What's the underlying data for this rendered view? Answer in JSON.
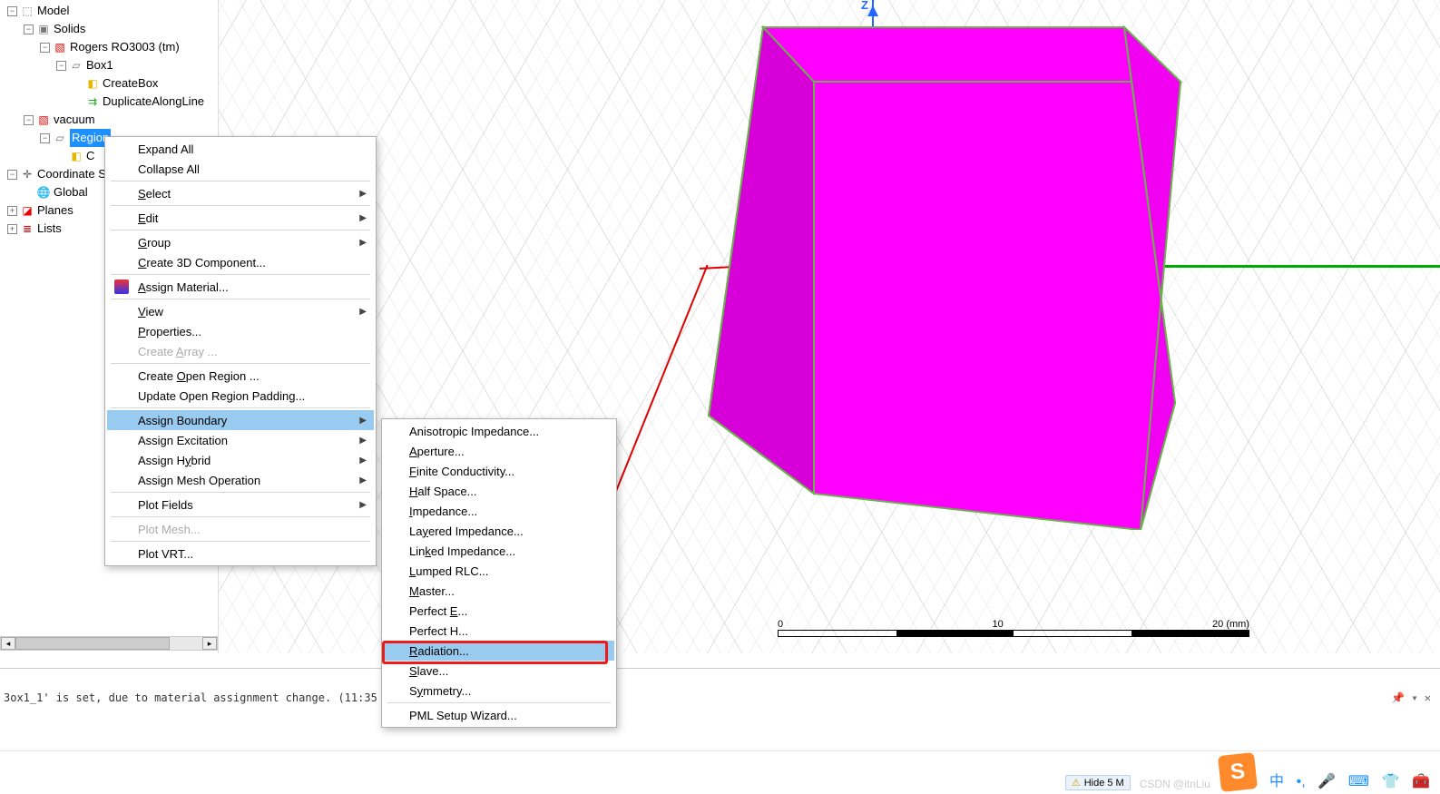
{
  "tree": {
    "model": "Model",
    "solids": "Solids",
    "material": "Rogers RO3003 (tm)",
    "box1": "Box1",
    "createBox": "CreateBox",
    "duplicate": "DuplicateAlongLine",
    "vacuum": "vacuum",
    "region": "Region",
    "regionSub": "C",
    "coord": "Coordinate S",
    "global": "Global",
    "planes": "Planes",
    "lists": "Lists"
  },
  "menu1": {
    "expandAll": "Expand All",
    "collapseAll": "Collapse All",
    "select": "Select",
    "edit": "Edit",
    "group": "Group",
    "create3d": "Create 3D Component...",
    "assignMat": "Assign Material...",
    "view": "View",
    "properties": "Properties...",
    "createArray": "Create Array ...",
    "createOpen": "Create Open Region ...",
    "updateOpen": "Update Open Region Padding...",
    "assignBoundary": "Assign Boundary",
    "assignExcitation": "Assign Excitation",
    "assignHybrid": "Assign Hybrid",
    "assignMesh": "Assign Mesh Operation",
    "plotFields": "Plot Fields",
    "plotMesh": "Plot Mesh...",
    "plotVRT": "Plot VRT..."
  },
  "menu2": {
    "aniso": "Anisotropic Impedance...",
    "aperture": "Aperture...",
    "finite": "Finite Conductivity...",
    "half": "Half Space...",
    "impedance": "Impedance...",
    "layered": "Layered Impedance...",
    "linked": "Linked Impedance...",
    "lumped": "Lumped RLC...",
    "master": "Master...",
    "perfectE": "Perfect E...",
    "perfectH": "Perfect H...",
    "radiation": "Radiation...",
    "slave": "Slave...",
    "symmetry": "Symmetry...",
    "pml": "PML Setup Wizard..."
  },
  "axis": {
    "z": "Z"
  },
  "ruler": {
    "zero": "0",
    "mid": "10",
    "end": "20 (mm)"
  },
  "status": {
    "text": "3ox1_1' is set, due to material assignment change. (11:35",
    "hide": "Hide 5 M"
  },
  "brand": "S",
  "watermark": "CSDN @itnLiu"
}
